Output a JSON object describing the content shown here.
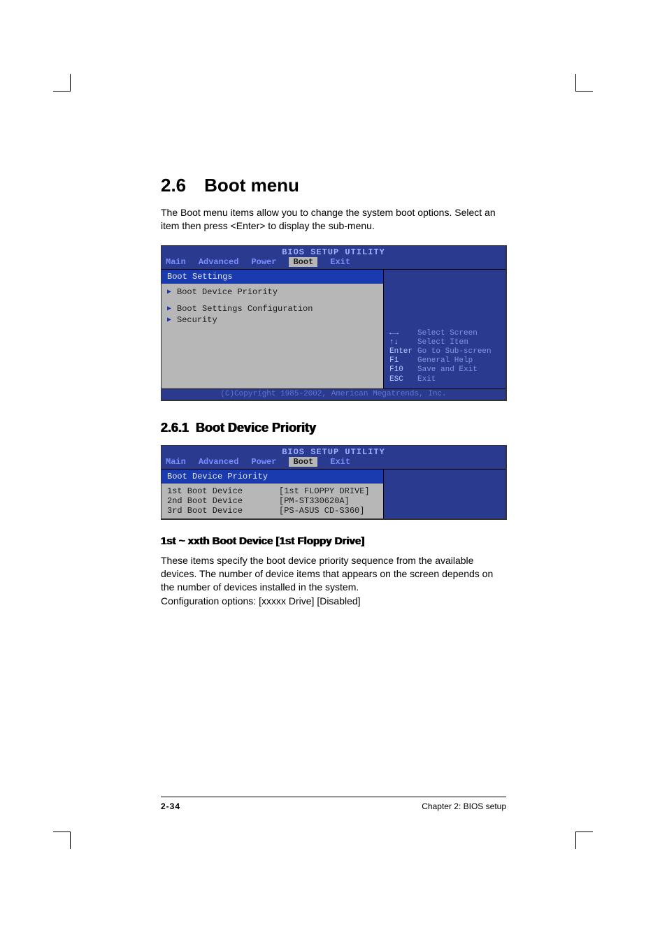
{
  "section": {
    "number": "2.6",
    "title": "Boot menu"
  },
  "intro": "The Boot menu items allow you to change the system boot options. Select an item then press <Enter> to display the sub-menu.",
  "bios1": {
    "title": "BIOS SETUP UTILITY",
    "tabs": [
      "Main",
      "Advanced",
      "Power",
      "Boot",
      "Exit"
    ],
    "active_tab": "Boot",
    "header": "Boot Settings",
    "items": [
      "Boot Device Priority",
      "Boot Settings Configuration",
      "Security"
    ],
    "help": [
      {
        "k": "←→",
        "v": "Select Screen"
      },
      {
        "k": "↑↓",
        "v": "Select Item"
      },
      {
        "k": "Enter",
        "v": "Go to Sub-screen"
      },
      {
        "k": "F1",
        "v": "General Help"
      },
      {
        "k": "F10",
        "v": "Save and Exit"
      },
      {
        "k": "ESC",
        "v": "Exit"
      }
    ],
    "copyright": "(C)Copyright 1985-2002, American Megatrends, Inc."
  },
  "subsec": {
    "number": "2.6.1",
    "title": "Boot Device Priority"
  },
  "bios2": {
    "title": "BIOS SETUP UTILITY",
    "tabs": [
      "Main",
      "Advanced",
      "Power",
      "Boot",
      "Exit"
    ],
    "active_tab": "Boot",
    "header": "Boot Device Priority",
    "rows": [
      {
        "k": "1st Boot Device",
        "v": "[1st FLOPPY DRIVE]"
      },
      {
        "k": "2nd Boot Device",
        "v": "[PM-ST330620A]"
      },
      {
        "k": "3rd Boot Device",
        "v": "[PS-ASUS CD-S360]"
      }
    ]
  },
  "opt": {
    "heading": "1st ~ xxth Boot Device [1st Floppy Drive]",
    "para1": "These items specify the boot device priority sequence from the available devices. The number of device items that appears on the screen depends on the number of devices installed in the system.",
    "para2": "Configuration options: [xxxxx Drive] [Disabled]"
  },
  "footer": {
    "page": "2-34",
    "chapter": "Chapter 2: BIOS setup"
  }
}
